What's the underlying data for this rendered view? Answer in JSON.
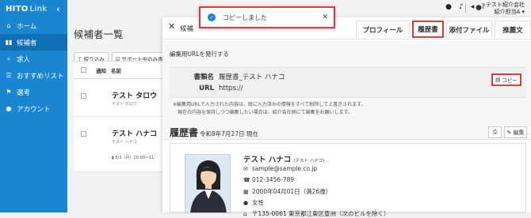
{
  "brand": {
    "name": "HITO",
    "suffix": "Link",
    "collapse_glyph": "‹"
  },
  "sidebar": {
    "items": [
      {
        "icon": "⌂",
        "label": "ホーム"
      },
      {
        "icon": "▮▮",
        "label": "候補者"
      },
      {
        "icon": "⌕",
        "label": "求人"
      },
      {
        "icon": "☰",
        "label": "おすすめリスト"
      },
      {
        "icon": "⚑",
        "label": "選考"
      },
      {
        "icon": "●",
        "label": "アカウント"
      }
    ]
  },
  "topbar": {
    "company_line1": "テスト紹介会社",
    "company_line2": "紹介担当A ▾",
    "icons": [
      "●",
      "♪",
      "◂",
      "?"
    ]
  },
  "list": {
    "title": "候補者一覧",
    "filter_btn": "絞り込み",
    "support_filter": "サポート中のみ表示",
    "columns": {
      "notify": "通知",
      "name": "名前"
    },
    "rows": [
      {
        "name": "テスト タロウ",
        "kana": "テスト タロウ",
        "date": ""
      },
      {
        "name": "テスト ハナコ",
        "kana": "テスト ハナコ",
        "date": "8/3（月）10:00〜11:"
      }
    ]
  },
  "panel": {
    "close": "✕",
    "title": "候補",
    "tabs": {
      "profile": "プロフィール",
      "resume": "履歴書",
      "attachments": "添付ファイル",
      "recommend": "推薦文"
    },
    "url_section": {
      "title": "編集用URLを発行する",
      "doc_label": "書類名",
      "doc_value": "履歴書_テスト ハナコ",
      "url_label": "URL",
      "url_value": "https://",
      "copy_label": "コピー",
      "note1": "※編集用URLで入力された内容は、既に入力済みの情報をすべて削除して上書きされます。",
      "note2": "現在の内容を保持しつつ編集したい場合は、紹介会社側にて編集をお願いします。"
    },
    "resume": {
      "title": "履歴書",
      "date": "令和8年7月27日 現在",
      "print_icon": "⎙",
      "edit_label": "✎ 編集",
      "name": "テスト ハナコ",
      "kana": "(テスト ハナコ)",
      "email": "sample@sample.co.jp",
      "phone": "012-3456-789",
      "birthday": "2000年04月01日（満26歳）",
      "gender": "女性",
      "address": "〒135-0061 東京都江東区豊洲（次のビルを除く）"
    }
  },
  "toast": {
    "message": "コピーしました",
    "close": "✕"
  },
  "colors": {
    "brand": "#1a86d0",
    "highlight": "#d83b3b"
  }
}
